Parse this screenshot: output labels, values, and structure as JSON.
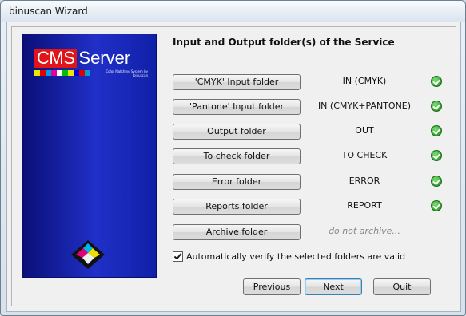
{
  "window": {
    "title": "binuscan Wizard"
  },
  "banner": {
    "logo_cms": "CMS",
    "logo_server": "Server",
    "logo_tagline": "Color Matching System by binuscan",
    "strip_colors": [
      "#e8e800",
      "#e00000",
      "#00a0e0",
      "#e000a0",
      "#ffffff",
      "#00c000",
      "#e8e800",
      "#0000e0",
      "#e00000",
      "#00a0e0"
    ]
  },
  "heading": "Input and Output folder(s) of the Service",
  "folders": [
    {
      "label": "'CMYK' Input folder",
      "value": "IN (CMYK)",
      "valid": true
    },
    {
      "label": "'Pantone' Input folder",
      "value": "IN (CMYK+PANTONE)",
      "valid": true
    },
    {
      "label": "Output folder",
      "value": "OUT",
      "valid": true
    },
    {
      "label": "To check folder",
      "value": "TO CHECK",
      "valid": true
    },
    {
      "label": "Error folder",
      "value": "ERROR",
      "valid": true
    },
    {
      "label": "Reports folder",
      "value": "REPORT",
      "valid": true
    },
    {
      "label": "Archive folder",
      "value": "do not archive...",
      "valid": false
    }
  ],
  "verify": {
    "label": "Automatically verify the selected folders are valid",
    "checked": true
  },
  "buttons": {
    "previous": "Previous",
    "next": "Next",
    "quit": "Quit"
  }
}
